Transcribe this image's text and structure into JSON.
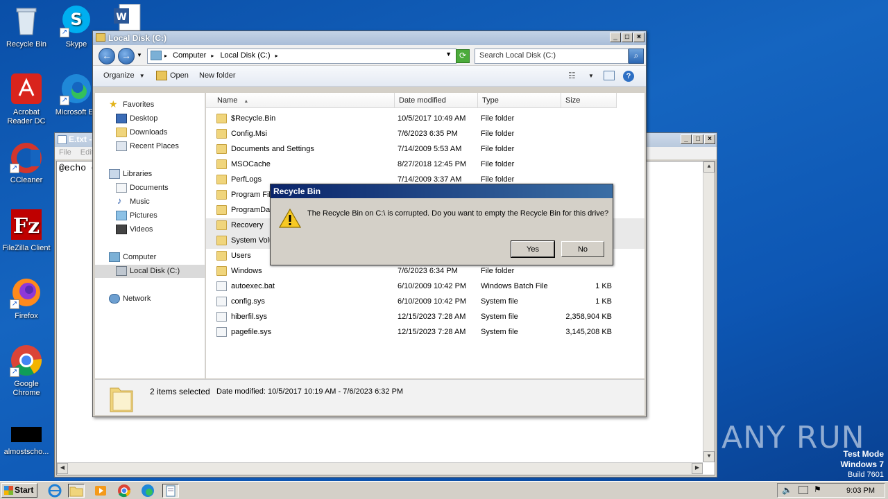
{
  "desktop": {
    "icons": [
      {
        "label": "Recycle Bin",
        "icon": "recycle-bin-icon"
      },
      {
        "label": "Skype",
        "icon": "skype-icon"
      },
      {
        "label": "Acrobat Reader DC",
        "icon": "acrobat-icon"
      },
      {
        "label": "Microsoft Ec",
        "icon": "edge-icon"
      },
      {
        "label": "CCleaner",
        "icon": "ccleaner-icon"
      },
      {
        "label": "FileZilla Client",
        "icon": "filezilla-icon"
      },
      {
        "label": "Firefox",
        "icon": "firefox-icon"
      },
      {
        "label": "Google Chrome",
        "icon": "chrome-icon"
      },
      {
        "label": "almostscho...",
        "icon": "terminal-icon"
      }
    ]
  },
  "notepad": {
    "title": "E.txt - ",
    "menu": [
      "File",
      "Edit"
    ],
    "content": "@echo o"
  },
  "explorer": {
    "title": "Local Disk (C:)",
    "address": {
      "crumbs": [
        "Computer",
        "Local Disk (C:)"
      ]
    },
    "search_placeholder": "Search Local Disk (C:)",
    "toolbar": {
      "organize": "Organize",
      "open": "Open",
      "new_folder": "New folder"
    },
    "nav": {
      "favorites": "Favorites",
      "desktop": "Desktop",
      "downloads": "Downloads",
      "recent": "Recent Places",
      "libraries": "Libraries",
      "documents": "Documents",
      "music": "Music",
      "pictures": "Pictures",
      "videos": "Videos",
      "computer": "Computer",
      "local_disk": "Local Disk (C:)",
      "network": "Network"
    },
    "columns": [
      "Name",
      "Date modified",
      "Type",
      "Size"
    ],
    "rows": [
      {
        "name": "$Recycle.Bin",
        "date": "10/5/2017 10:49 AM",
        "type": "File folder",
        "size": ""
      },
      {
        "name": "Config.Msi",
        "date": "7/6/2023 6:35 PM",
        "type": "File folder",
        "size": ""
      },
      {
        "name": "Documents and Settings",
        "date": "7/14/2009 5:53 AM",
        "type": "File folder",
        "size": ""
      },
      {
        "name": "MSOCache",
        "date": "8/27/2018 12:45 PM",
        "type": "File folder",
        "size": ""
      },
      {
        "name": "PerfLogs",
        "date": "7/14/2009 3:37 AM",
        "type": "File folder",
        "size": ""
      },
      {
        "name": "Program File",
        "date": "",
        "type": "",
        "size": ""
      },
      {
        "name": "ProgramDat",
        "date": "",
        "type": "",
        "size": ""
      },
      {
        "name": "Recovery",
        "date": "",
        "type": "",
        "size": ""
      },
      {
        "name": "System Volu",
        "date": "",
        "type": "",
        "size": ""
      },
      {
        "name": "Users",
        "date": "",
        "type": "",
        "size": ""
      },
      {
        "name": "Windows",
        "date": "7/6/2023 6:34 PM",
        "type": "File folder",
        "size": ""
      },
      {
        "name": "autoexec.bat",
        "date": "6/10/2009 10:42 PM",
        "type": "Windows Batch File",
        "size": "1 KB"
      },
      {
        "name": "config.sys",
        "date": "6/10/2009 10:42 PM",
        "type": "System file",
        "size": "1 KB"
      },
      {
        "name": "hiberfil.sys",
        "date": "12/15/2023 7:28 AM",
        "type": "System file",
        "size": "2,358,904 KB"
      },
      {
        "name": "pagefile.sys",
        "date": "12/15/2023 7:28 AM",
        "type": "System file",
        "size": "3,145,208 KB"
      }
    ],
    "status": {
      "selected": "2 items selected",
      "detail": "Date modified: 10/5/2017 10:19 AM - 7/6/2023 6:32 PM"
    }
  },
  "dialog": {
    "title": "Recycle Bin",
    "message": "The Recycle Bin on C:\\ is corrupted. Do you want to empty the Recycle Bin for this drive?",
    "yes": "Yes",
    "no": "No"
  },
  "taskbar": {
    "start": "Start",
    "clock": "9:03 PM"
  },
  "watermark": "ANY RUN",
  "test_mode": {
    "line1": "Test Mode",
    "line2": "Windows 7",
    "line3": "Build 7601"
  }
}
